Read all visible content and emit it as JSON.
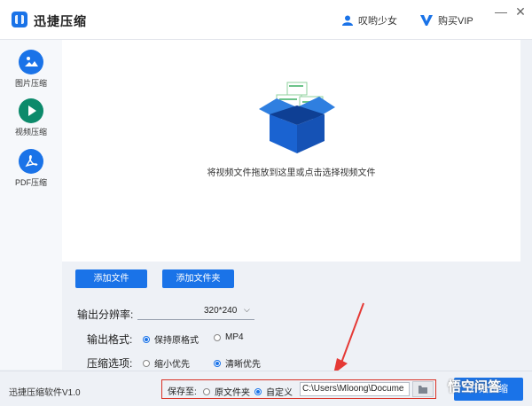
{
  "app": {
    "title": "迅捷压缩"
  },
  "topbar": {
    "user_label": "叹哟少女",
    "vip_label": "购买VIP"
  },
  "window": {
    "min": "—",
    "close": "✕"
  },
  "sidebar": {
    "items": [
      {
        "label": "图片压缩",
        "icon": "image-icon"
      },
      {
        "label": "视频压缩",
        "icon": "play-icon"
      },
      {
        "label": "PDF压缩",
        "icon": "pdf-icon"
      }
    ]
  },
  "dropzone": {
    "hint": "将视频文件拖放到这里或点击选择视频文件"
  },
  "buttons": {
    "add_file": "添加文件",
    "add_folder": "添加文件夹",
    "start": "开始压缩"
  },
  "settings": {
    "resolution_label": "输出分辨率:",
    "resolution_value": "320*240",
    "format_label": "输出格式:",
    "format_options": [
      "保持原格式",
      "MP4"
    ],
    "format_selected": "保持原格式",
    "compress_label": "压缩选项:",
    "compress_options": [
      "缩小优先",
      "清晰优先"
    ],
    "compress_selected": "清晰优先"
  },
  "footer": {
    "version": "迅捷压缩软件V1.0",
    "save_to_label": "保存至:",
    "save_options": [
      "原文件夹",
      "自定义"
    ],
    "save_selected": "自定义",
    "path_value": "C:\\Users\\Mloong\\Docume"
  },
  "watermark": {
    "text": "悟空问答"
  },
  "colors": {
    "accent": "#1a73e8",
    "highlight_border": "#d93025",
    "arrow": "#e53935"
  }
}
